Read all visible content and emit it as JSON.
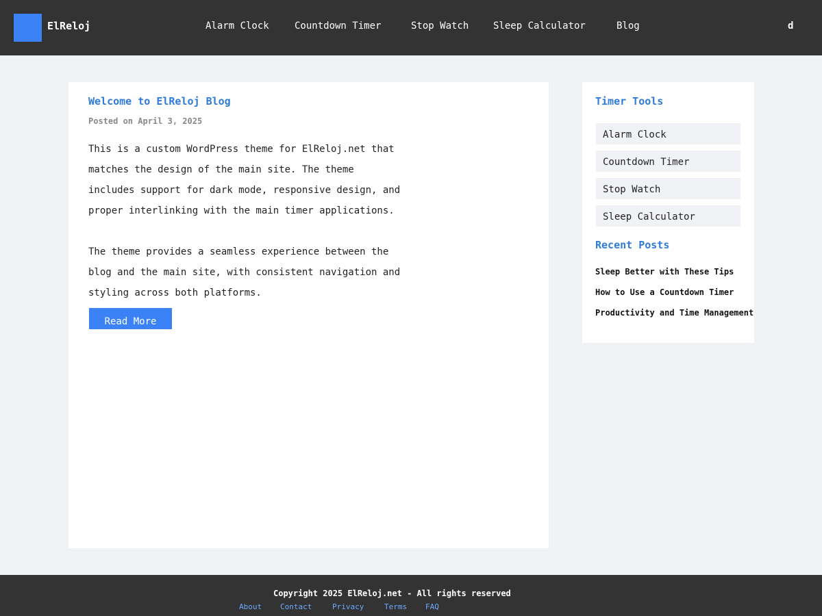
{
  "header": {
    "logo_text": "ElReloj",
    "nav": [
      "Alarm Clock",
      "Countdown Timer",
      "Stop Watch",
      "Sleep Calculator",
      "Blog"
    ],
    "mode_toggle": "d"
  },
  "post": {
    "title": "Welcome to ElReloj Blog",
    "meta": "Posted on April 3, 2025",
    "paragraphs": [
      "This is a custom WordPress theme for ElReloj.net that matches the design of the main site. The theme includes support for dark mode, responsive design, and proper interlinking with the main timer applications.",
      "The theme provides a seamless experience between the blog and the main site, with consistent navigation and styling across both platforms."
    ],
    "read_more": "Read More"
  },
  "sidebar": {
    "tools_heading": "Timer Tools",
    "tools": [
      "Alarm Clock",
      "Countdown Timer",
      "Stop Watch",
      "Sleep Calculator"
    ],
    "recent_heading": "Recent Posts",
    "recent_posts": [
      "Sleep Better with These Tips",
      "How to Use a Countdown Timer",
      "Productivity and Time Management"
    ]
  },
  "footer": {
    "copyright": "Copyright 2025 ElReloj.net - All rights reserved",
    "links": [
      "About",
      "Contact",
      "Privacy",
      "Terms",
      "FAQ"
    ]
  },
  "colors": {
    "accent": "#3b82f6",
    "link": "#2f7bd8",
    "header_bg": "#333333",
    "page_bg": "#f0f2f5"
  }
}
